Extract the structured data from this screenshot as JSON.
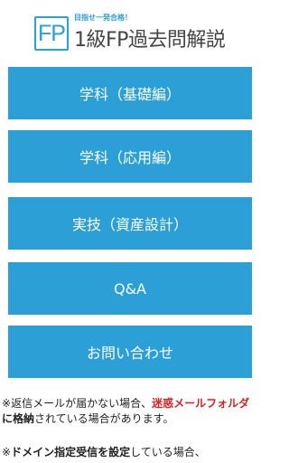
{
  "header": {
    "logo_text": "FP",
    "tagline": "目指せ一発合格！",
    "title": "1級FP過去問解説",
    "accent_color": "#2b9fd6"
  },
  "menu": [
    {
      "label": "学科（基礎編）"
    },
    {
      "label": "学科（応用編）"
    },
    {
      "label": "実技（資産設計）"
    },
    {
      "label": "Q&A"
    },
    {
      "label": "お問い合わせ"
    }
  ],
  "notes": {
    "note1": {
      "mark": "※",
      "part1": "返信メールが届かない場合、",
      "highlight": "迷惑メールフォルダ",
      "part2_bold": "に格納",
      "part3": "されている場合があります。"
    },
    "note2": {
      "mark": "※",
      "bold": "ドメイン指定受信を設定",
      "rest": "している場合、"
    }
  }
}
